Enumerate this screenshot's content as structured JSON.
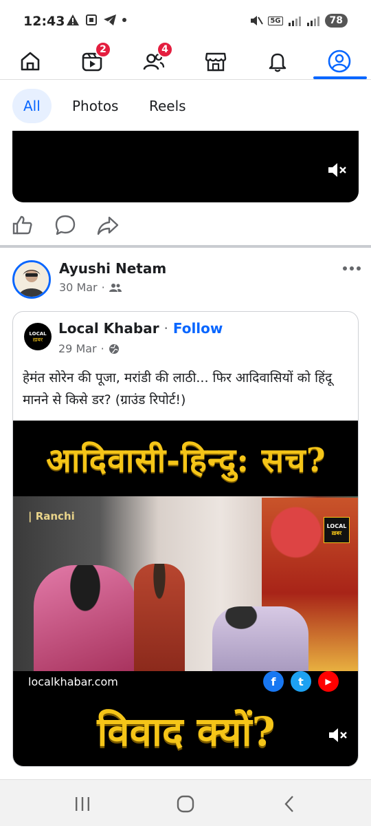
{
  "status_bar": {
    "time": "12:43",
    "network": "5G",
    "battery": "78"
  },
  "nav": {
    "tabs": [
      {
        "name": "home",
        "icon": "home-icon"
      },
      {
        "name": "video",
        "icon": "video-icon",
        "badge": "2"
      },
      {
        "name": "friends",
        "icon": "friends-icon",
        "badge": "4"
      },
      {
        "name": "marketplace",
        "icon": "marketplace-icon"
      },
      {
        "name": "notifications",
        "icon": "bell-icon"
      },
      {
        "name": "profile",
        "icon": "profile-icon",
        "active": true
      }
    ],
    "active_color": "#0866ff",
    "badge_color": "#e41e3f"
  },
  "filters": {
    "tabs": [
      "All",
      "Photos",
      "Reels"
    ],
    "active": "All"
  },
  "post": {
    "author": "Ayushi Netam",
    "date": "30 Mar",
    "privacy_icon": "friends-icon",
    "shared": {
      "page_name": "Local Khabar",
      "separator": "·",
      "follow_label": "Follow",
      "date": "29 Mar",
      "privacy_icon": "globe-icon",
      "text": "हेमंत सोरेन की पूजा, मरांडी की लाठी... फिर आदिवासियों को हिंदू मानने से किसे डर? (ग्राउंड रिपोर्ट!)",
      "logo_top": "LOCAL",
      "logo_bottom": "ख़बर",
      "thumbnail": {
        "headline_top": "आदिवासी-हिन्दु: सच?",
        "tag": "| Ranchi",
        "site": "localkhabar.com",
        "headline_bottom": "विवाद क्यों?",
        "social": [
          {
            "label": "f",
            "color": "#1877f2"
          },
          {
            "label": "t",
            "color": "#1da1f2"
          },
          {
            "label": "▶",
            "color": "#ff0000"
          }
        ]
      }
    }
  }
}
